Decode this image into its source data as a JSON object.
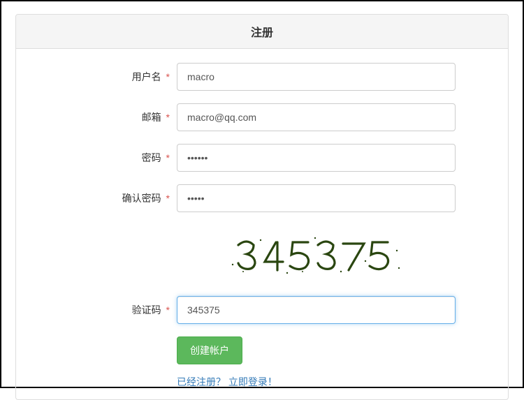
{
  "panel": {
    "title": "注册"
  },
  "form": {
    "username": {
      "label": "用户名",
      "value": "macro"
    },
    "email": {
      "label": "邮箱",
      "value": "macro@qq.com"
    },
    "password": {
      "label": "密码",
      "value": "••••••"
    },
    "confirmPassword": {
      "label": "确认密码",
      "value": "•••••"
    },
    "captcha": {
      "label": "验证码",
      "value": "345375",
      "imageText": "345375"
    },
    "submit": {
      "label": "创建帐户"
    },
    "loginLink": {
      "prefix": "已经注册？",
      "link": "立即登录！"
    },
    "requiredMark": "*"
  }
}
